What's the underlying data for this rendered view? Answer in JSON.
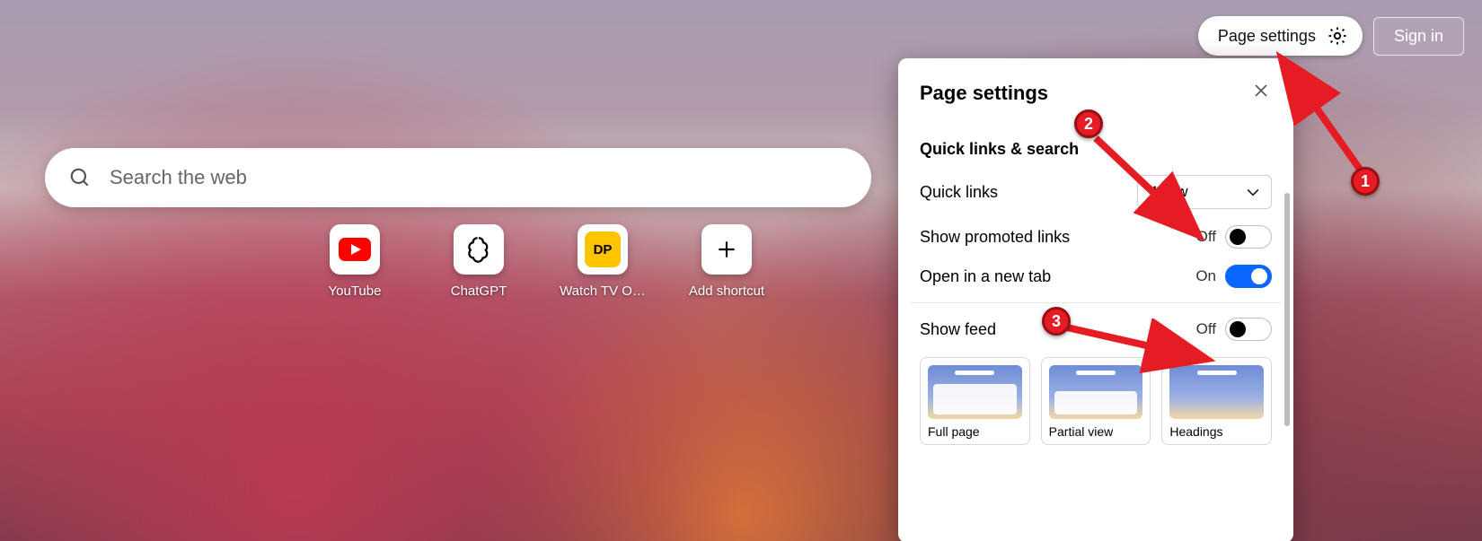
{
  "top": {
    "page_settings_label": "Page settings",
    "sign_in_label": "Sign in"
  },
  "search": {
    "placeholder": "Search the web"
  },
  "tiles": [
    {
      "label": "YouTube",
      "kind": "youtube"
    },
    {
      "label": "ChatGPT",
      "kind": "chatgpt"
    },
    {
      "label": "Watch TV O…",
      "kind": "dp"
    },
    {
      "label": "Add shortcut",
      "kind": "add"
    }
  ],
  "popup": {
    "title": "Page settings",
    "section_quick": "Quick links & search",
    "quick_links_label": "Quick links",
    "quick_links_value": "1 row",
    "promoted_label": "Show promoted links",
    "promoted_state": "Off",
    "newtab_label": "Open in a new tab",
    "newtab_state": "On",
    "feed_label": "Show feed",
    "feed_state": "Off",
    "feed_options": [
      "Full page",
      "Partial view",
      "Headings"
    ]
  },
  "annotations": {
    "b1": "1",
    "b2": "2",
    "b3": "3"
  }
}
